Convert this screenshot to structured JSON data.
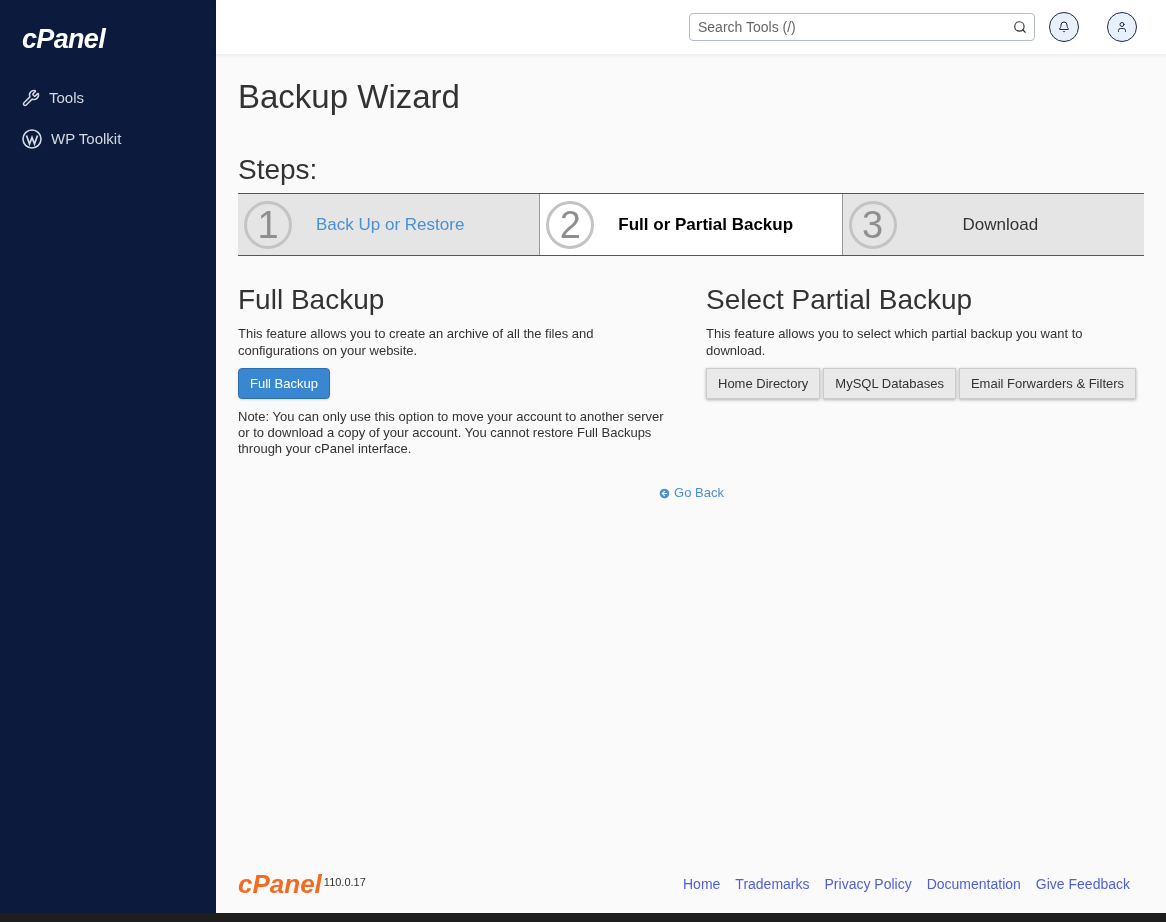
{
  "sidebar": {
    "logo": "cPanel",
    "items": [
      {
        "label": "Tools",
        "kind": "tools",
        "selected": false
      },
      {
        "label": "WP Toolkit",
        "kind": "wordpress",
        "selected": false
      }
    ]
  },
  "header": {
    "search": {
      "placeholder": "Search Tools (/)"
    }
  },
  "page": {
    "title": "Backup Wizard",
    "steps_heading": "Steps:",
    "steps": [
      {
        "number": "1",
        "label": "Back Up or Restore",
        "selected": false,
        "kind": "link"
      },
      {
        "number": "2",
        "label": "Full or Partial Backup",
        "selected": true,
        "kind": "current"
      },
      {
        "number": "3",
        "label": "Download",
        "selected": false,
        "kind": "plain"
      }
    ],
    "full_backup": {
      "title": "Full Backup",
      "description": "This feature allows you to create an archive of all the files and configurations on your website.",
      "button": "Full Backup",
      "note": "Note: You can only use this option to move your account to another server or to download a copy of your account. You cannot restore Full Backups through your cPanel interface."
    },
    "partial_backup": {
      "title": "Select Partial Backup",
      "description": "This feature allows you to select which partial backup you want to download.",
      "buttons": [
        "Home Directory",
        "MySQL Databases",
        "Email Forwarders & Filters"
      ]
    },
    "go_back": "Go Back"
  },
  "footer": {
    "logo": "cPanel",
    "version": "110.0.17",
    "links": [
      "Home",
      "Trademarks",
      "Privacy Policy",
      "Documentation",
      "Give Feedback"
    ]
  }
}
